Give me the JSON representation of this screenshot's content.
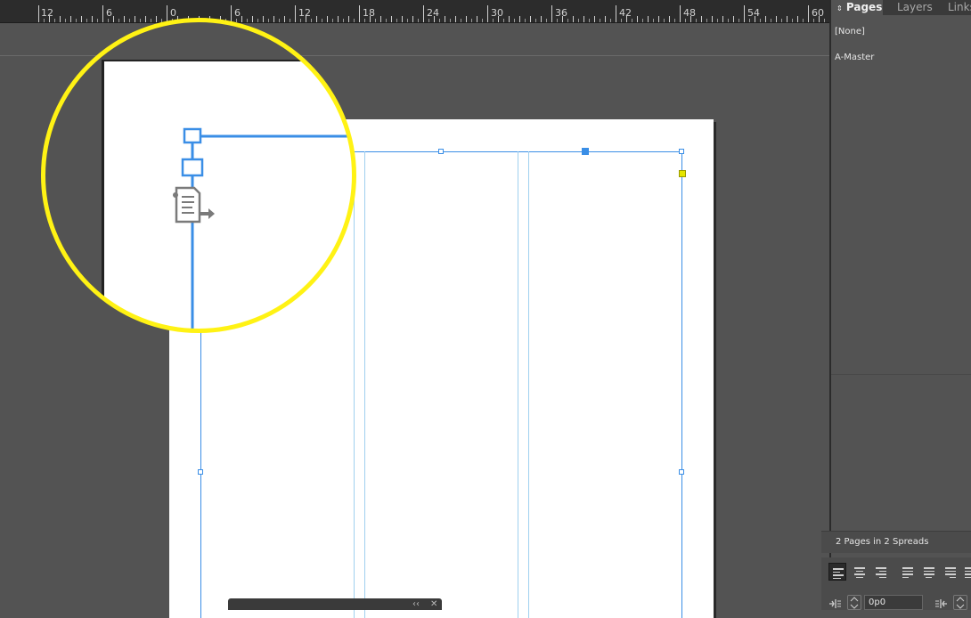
{
  "ruler": {
    "labels": [
      "12",
      "6",
      "0",
      "6",
      "12",
      "18",
      "24",
      "30",
      "36",
      "42",
      "48",
      "54",
      "60"
    ]
  },
  "panel": {
    "tabs": [
      {
        "label": "Pages",
        "active": true
      },
      {
        "label": "Layers",
        "active": false
      },
      {
        "label": "Links",
        "active": false
      }
    ],
    "masters": [
      "[None]",
      "A-Master"
    ],
    "status": "2 Pages in 2 Spreads"
  },
  "paragraph": {
    "left_indent": "0p0"
  },
  "floater": {
    "collapse_glyph": "‹‹",
    "close_glyph": "✕"
  },
  "icons": [
    "text-threading-icon",
    "in-port-icon",
    "out-port-icon",
    "close-icon",
    "collapse-icon",
    "left-indent-icon",
    "right-indent-icon"
  ],
  "colors": {
    "selection": "#3a8ee6",
    "magnifier_ring": "#fff214",
    "out_port": "#e6e600"
  }
}
